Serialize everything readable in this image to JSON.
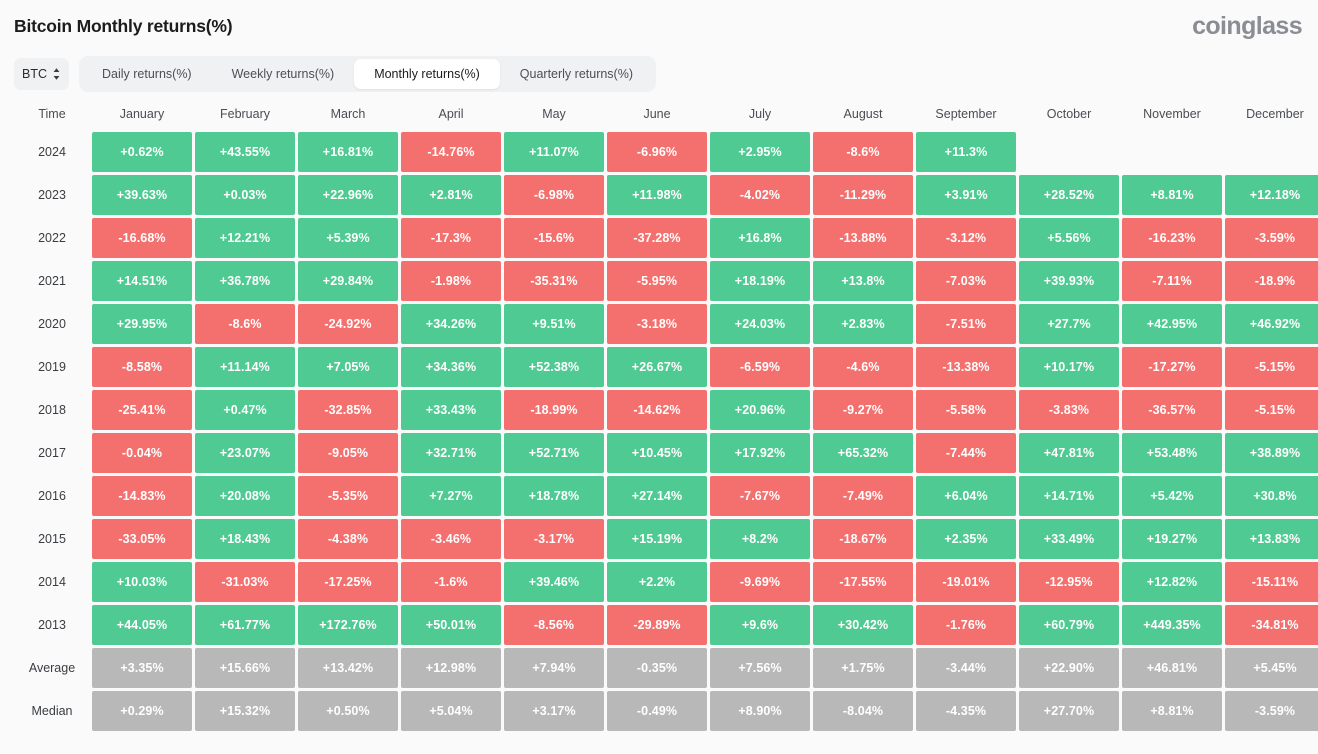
{
  "header": {
    "title": "Bitcoin Monthly returns(%)",
    "brand": "coinglass"
  },
  "controls": {
    "symbol": "BTC",
    "symbol_icon": "chevron-updown-icon",
    "tabs": [
      {
        "label": "Daily returns(%)",
        "active": false
      },
      {
        "label": "Weekly returns(%)",
        "active": false
      },
      {
        "label": "Monthly returns(%)",
        "active": true
      },
      {
        "label": "Quarterly returns(%)",
        "active": false
      }
    ]
  },
  "colors": {
    "positive": "#50ca93",
    "negative": "#f4706e",
    "stat": "#b8b8b8",
    "background": "#fafafa",
    "tab_active_bg": "#ffffff",
    "tab_group_bg": "#f0f1f3"
  },
  "chart_data": {
    "type": "heatmap",
    "title": "Bitcoin Monthly returns(%)",
    "xlabel": "",
    "ylabel": "Time",
    "categories": [
      "January",
      "February",
      "March",
      "April",
      "May",
      "June",
      "July",
      "August",
      "September",
      "October",
      "November",
      "December"
    ],
    "row_header": "Time",
    "rows": [
      {
        "label": "2024",
        "kind": "year",
        "values": [
          "+0.62%",
          "+43.55%",
          "+16.81%",
          "-14.76%",
          "+11.07%",
          "-6.96%",
          "+2.95%",
          "-8.6%",
          "+11.3%",
          "",
          "",
          ""
        ]
      },
      {
        "label": "2023",
        "kind": "year",
        "values": [
          "+39.63%",
          "+0.03%",
          "+22.96%",
          "+2.81%",
          "-6.98%",
          "+11.98%",
          "-4.02%",
          "-11.29%",
          "+3.91%",
          "+28.52%",
          "+8.81%",
          "+12.18%"
        ]
      },
      {
        "label": "2022",
        "kind": "year",
        "values": [
          "-16.68%",
          "+12.21%",
          "+5.39%",
          "-17.3%",
          "-15.6%",
          "-37.28%",
          "+16.8%",
          "-13.88%",
          "-3.12%",
          "+5.56%",
          "-16.23%",
          "-3.59%"
        ]
      },
      {
        "label": "2021",
        "kind": "year",
        "values": [
          "+14.51%",
          "+36.78%",
          "+29.84%",
          "-1.98%",
          "-35.31%",
          "-5.95%",
          "+18.19%",
          "+13.8%",
          "-7.03%",
          "+39.93%",
          "-7.11%",
          "-18.9%"
        ]
      },
      {
        "label": "2020",
        "kind": "year",
        "values": [
          "+29.95%",
          "-8.6%",
          "-24.92%",
          "+34.26%",
          "+9.51%",
          "-3.18%",
          "+24.03%",
          "+2.83%",
          "-7.51%",
          "+27.7%",
          "+42.95%",
          "+46.92%"
        ]
      },
      {
        "label": "2019",
        "kind": "year",
        "values": [
          "-8.58%",
          "+11.14%",
          "+7.05%",
          "+34.36%",
          "+52.38%",
          "+26.67%",
          "-6.59%",
          "-4.6%",
          "-13.38%",
          "+10.17%",
          "-17.27%",
          "-5.15%"
        ]
      },
      {
        "label": "2018",
        "kind": "year",
        "values": [
          "-25.41%",
          "+0.47%",
          "-32.85%",
          "+33.43%",
          "-18.99%",
          "-14.62%",
          "+20.96%",
          "-9.27%",
          "-5.58%",
          "-3.83%",
          "-36.57%",
          "-5.15%"
        ]
      },
      {
        "label": "2017",
        "kind": "year",
        "values": [
          "-0.04%",
          "+23.07%",
          "-9.05%",
          "+32.71%",
          "+52.71%",
          "+10.45%",
          "+17.92%",
          "+65.32%",
          "-7.44%",
          "+47.81%",
          "+53.48%",
          "+38.89%"
        ]
      },
      {
        "label": "2016",
        "kind": "year",
        "values": [
          "-14.83%",
          "+20.08%",
          "-5.35%",
          "+7.27%",
          "+18.78%",
          "+27.14%",
          "-7.67%",
          "-7.49%",
          "+6.04%",
          "+14.71%",
          "+5.42%",
          "+30.8%"
        ]
      },
      {
        "label": "2015",
        "kind": "year",
        "values": [
          "-33.05%",
          "+18.43%",
          "-4.38%",
          "-3.46%",
          "-3.17%",
          "+15.19%",
          "+8.2%",
          "-18.67%",
          "+2.35%",
          "+33.49%",
          "+19.27%",
          "+13.83%"
        ]
      },
      {
        "label": "2014",
        "kind": "year",
        "values": [
          "+10.03%",
          "-31.03%",
          "-17.25%",
          "-1.6%",
          "+39.46%",
          "+2.2%",
          "-9.69%",
          "-17.55%",
          "-19.01%",
          "-12.95%",
          "+12.82%",
          "-15.11%"
        ]
      },
      {
        "label": "2013",
        "kind": "year",
        "values": [
          "+44.05%",
          "+61.77%",
          "+172.76%",
          "+50.01%",
          "-8.56%",
          "-29.89%",
          "+9.6%",
          "+30.42%",
          "-1.76%",
          "+60.79%",
          "+449.35%",
          "-34.81%"
        ]
      },
      {
        "label": "Average",
        "kind": "stat",
        "values": [
          "+3.35%",
          "+15.66%",
          "+13.42%",
          "+12.98%",
          "+7.94%",
          "-0.35%",
          "+7.56%",
          "+1.75%",
          "-3.44%",
          "+22.90%",
          "+46.81%",
          "+5.45%"
        ]
      },
      {
        "label": "Median",
        "kind": "stat",
        "values": [
          "+0.29%",
          "+15.32%",
          "+0.50%",
          "+5.04%",
          "+3.17%",
          "-0.49%",
          "+8.90%",
          "-8.04%",
          "-4.35%",
          "+27.70%",
          "+8.81%",
          "-3.59%"
        ]
      }
    ]
  }
}
